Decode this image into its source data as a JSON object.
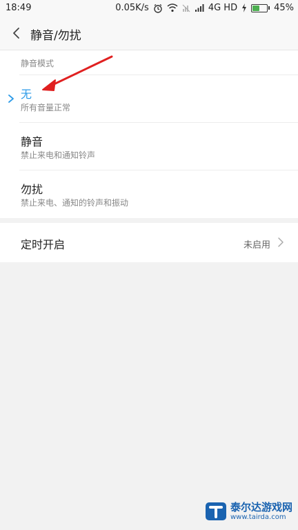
{
  "status_bar": {
    "time": "18:49",
    "speed": "0.05K/s",
    "network": "4G HD",
    "battery": "45%",
    "battery_level": 0.45
  },
  "header": {
    "title": "静音/勿扰"
  },
  "mode_section": {
    "header": "静音模式",
    "items": [
      {
        "label": "无",
        "description": "所有音量正常",
        "selected": true
      },
      {
        "label": "静音",
        "description": "禁止来电和通知铃声",
        "selected": false
      },
      {
        "label": "勿扰",
        "description": "禁止来电、通知的铃声和振动",
        "selected": false
      }
    ]
  },
  "schedule": {
    "label": "定时开启",
    "value": "未启用"
  },
  "watermark": {
    "title": "泰尔达游戏网",
    "url": "www.tairda.com"
  },
  "colors": {
    "accent": "#2d9be8",
    "annotation_arrow": "#e02020"
  }
}
